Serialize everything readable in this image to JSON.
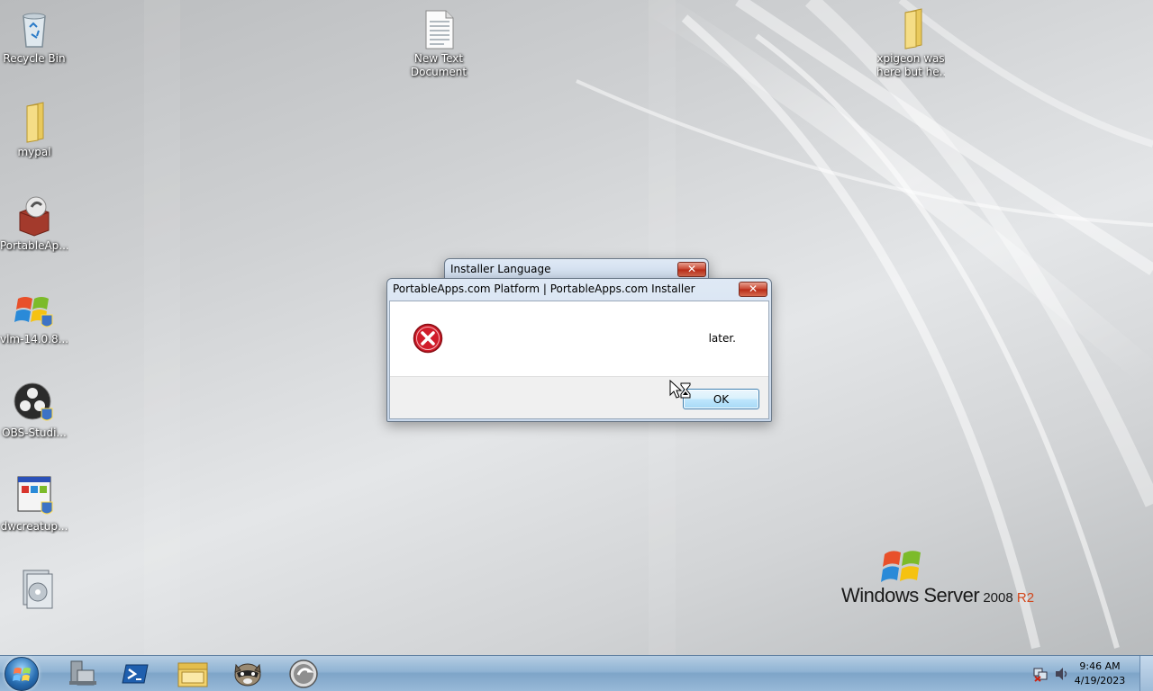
{
  "desktop": {
    "icons": [
      {
        "label": "Recycle Bin"
      },
      {
        "label": "mypal"
      },
      {
        "label": "PortableAp..."
      },
      {
        "label": "vlm-14.0.8..."
      },
      {
        "label": "OBS-Studi..."
      },
      {
        "label": "dwcreatup..."
      },
      {
        "label": ""
      },
      {
        "label_line1": "New Text",
        "label_line2": "Document"
      },
      {
        "label_line1": "xpigeon was",
        "label_line2": "here but he..."
      }
    ]
  },
  "background_window": {
    "title": "Installer Language",
    "close": "✕"
  },
  "dialog": {
    "title": "PortableApps.com Platform | PortableApps.com Installer",
    "close": "✕",
    "message": "later.",
    "ok_label": "OK"
  },
  "branding": {
    "part1": "Windows Server",
    "part2": " 2008",
    "part3": " R2"
  },
  "taskbar": {
    "pinned": [
      "server-manager-icon",
      "powershell-icon",
      "explorer-icon",
      "raccoon-app-icon",
      "portableapps-icon"
    ],
    "clock_time": "9:46 AM",
    "clock_date": "4/19/2023"
  },
  "colors": {
    "taskbar": "#8fb3d3",
    "close_button": "#c7432f",
    "error_icon": "#d01c2a"
  }
}
